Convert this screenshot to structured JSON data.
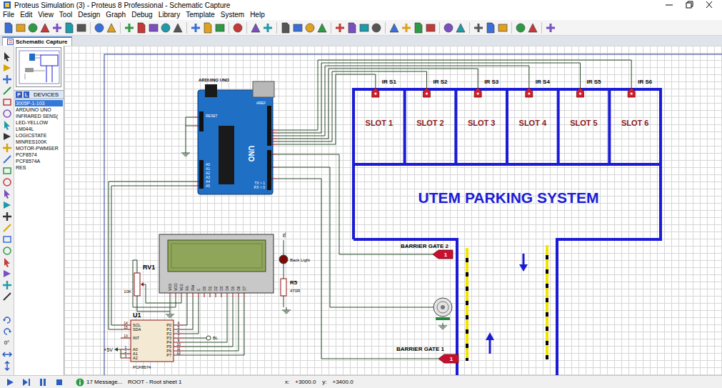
{
  "window": {
    "title": "Proteus Simulation (3) - Proteus 8 Professional - Schematic Capture"
  },
  "menu": [
    "File",
    "Edit",
    "View",
    "Tool",
    "Design",
    "Graph",
    "Debug",
    "Library",
    "Template",
    "System",
    "Help"
  ],
  "tabs": [
    {
      "label": "Schematic Capture",
      "selected": true
    }
  ],
  "devices": {
    "modes": [
      "P",
      "L"
    ],
    "header": "DEVICES",
    "items": [
      {
        "label": "3005P-1-103",
        "selected": true
      },
      {
        "label": "ARDUINO UNO",
        "selected": false
      },
      {
        "label": "INFRARED SENS(",
        "selected": false
      },
      {
        "label": "LED-YELLOW",
        "selected": false
      },
      {
        "label": "LM044L",
        "selected": false
      },
      {
        "label": "LOGICSTATE",
        "selected": false
      },
      {
        "label": "MINRES100K",
        "selected": false
      },
      {
        "label": "MOTOR-PWMSER",
        "selected": false
      },
      {
        "label": "PCF8574",
        "selected": false
      },
      {
        "label": "PCF8574A",
        "selected": false
      },
      {
        "label": "RES",
        "selected": false
      }
    ]
  },
  "rotation": "0°",
  "schematic": {
    "title": "UTEM PARKING SYSTEM",
    "slots": [
      {
        "name": "SLOT 1",
        "sensor": "IR S1"
      },
      {
        "name": "SLOT 2",
        "sensor": "IR S2"
      },
      {
        "name": "SLOT 3",
        "sensor": "IR S3"
      },
      {
        "name": "SLOT 4",
        "sensor": "IR S4"
      },
      {
        "name": "SLOT 5",
        "sensor": "IR S5"
      },
      {
        "name": "SLOT 6",
        "sensor": "IR S6"
      }
    ],
    "arduino": {
      "label": "ARDUINO UNO",
      "model": "UNO",
      "aref": "AREF",
      "reset": "RESET",
      "analog": [
        "A0",
        "A1",
        "A2",
        "A3",
        "A4",
        "A5"
      ],
      "serial": [
        "TX > 1",
        "RX < 0"
      ]
    },
    "gates": [
      {
        "label": "BARRIER GATE 2",
        "value": "1"
      },
      {
        "label": "BARRIER GATE 1",
        "value": "1"
      }
    ],
    "lcd": {
      "pins": [
        "VSS",
        "VDD",
        "VEE",
        "RS",
        "RW",
        "E",
        "D0",
        "D1",
        "D2",
        "D3",
        "D4",
        "D5",
        "D6",
        "D7"
      ]
    },
    "backlight": {
      "label": "Back Light",
      "net": "BL"
    },
    "resistor": {
      "ref": "R5",
      "value": "470R"
    },
    "pot": {
      "ref": "RV1",
      "value": "10K"
    },
    "expander": {
      "ref": "U1",
      "part": "PCF8574",
      "left_pins": [
        {
          "name": "SCL",
          "num": "14"
        },
        {
          "name": "SDA",
          "num": "15"
        },
        {
          "name": "INT",
          "num": "13"
        },
        {
          "name": "A0",
          "num": "1"
        },
        {
          "name": "A1",
          "num": "2"
        },
        {
          "name": "A2",
          "num": "3"
        }
      ],
      "right_pins": [
        {
          "name": "P0",
          "num": "4"
        },
        {
          "name": "P1",
          "num": "5"
        },
        {
          "name": "P2",
          "num": "6"
        },
        {
          "name": "P3",
          "num": "7"
        },
        {
          "name": "P4",
          "num": "9"
        },
        {
          "name": "P5",
          "num": "10"
        },
        {
          "name": "P6",
          "num": "11"
        },
        {
          "name": "P7",
          "num": "12"
        }
      ]
    },
    "power": "+5V",
    "bl_terminal": "BL"
  },
  "status_bar": {
    "messages": "17 Message...",
    "sheet": "ROOT - Root sheet 1",
    "x_label": "x:",
    "x": "+3000.0",
    "y_label": "y:",
    "y": "+3400.0"
  }
}
